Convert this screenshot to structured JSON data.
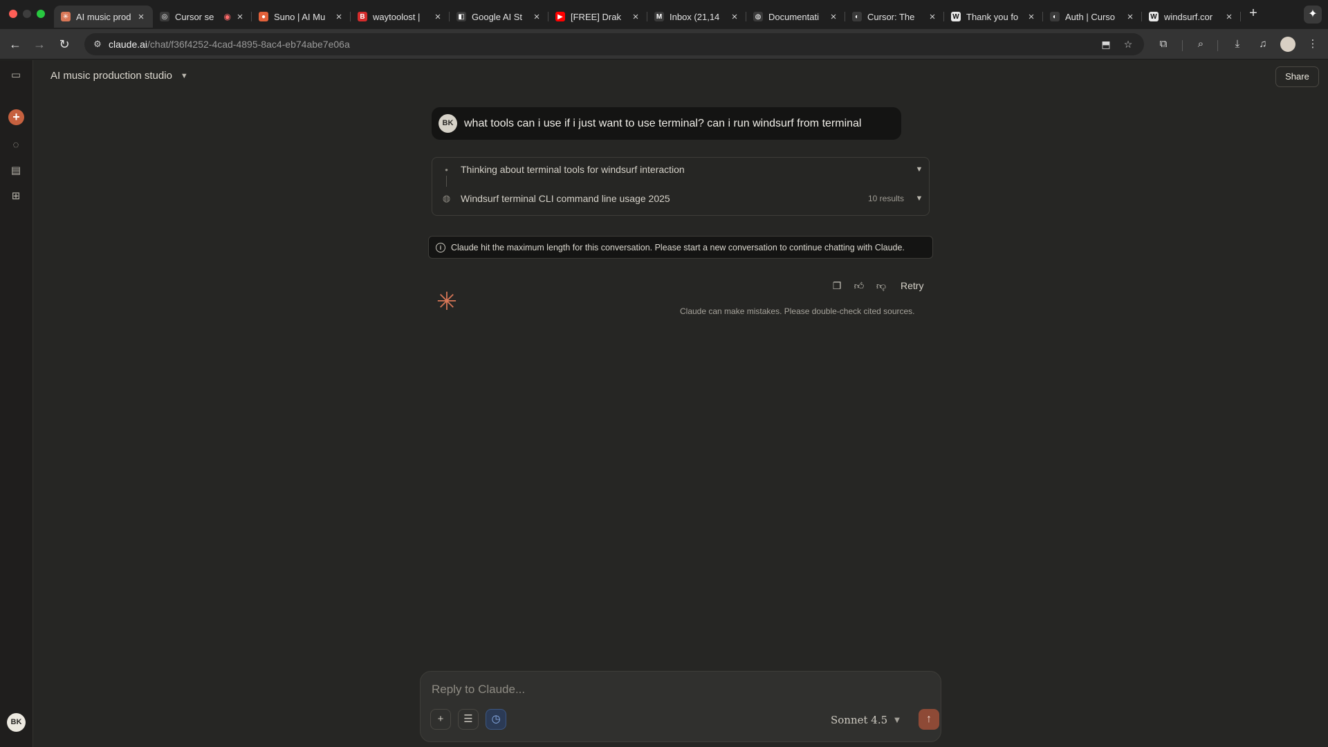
{
  "browser": {
    "tabs": [
      {
        "title": "AI music prod",
        "active": true,
        "favicon": "claude-icon",
        "fav_color": "#d97757",
        "fav_glyph": "✳"
      },
      {
        "title": "Cursor se",
        "active": false,
        "favicon": "cursor-icon",
        "fav_color": "#3a3a3a",
        "fav_glyph": "◎",
        "badge": "recording-icon"
      },
      {
        "title": "Suno | AI Mu",
        "active": false,
        "favicon": "suno-icon",
        "fav_color": "#e2613a",
        "fav_glyph": "●"
      },
      {
        "title": "waytoolost |",
        "active": false,
        "favicon": "bandcamp-icon",
        "fav_color": "#d42b2b",
        "fav_glyph": "B"
      },
      {
        "title": "Google AI St",
        "active": false,
        "favicon": "google-ai-studio-icon",
        "fav_color": "#3a3a3a",
        "fav_glyph": "◧"
      },
      {
        "title": "[FREE] Drak",
        "active": false,
        "favicon": "youtube-icon",
        "fav_color": "#ff0000",
        "fav_glyph": "▶"
      },
      {
        "title": "Inbox (21,14",
        "active": false,
        "favicon": "gmail-icon",
        "fav_color": "#3a3a3a",
        "fav_glyph": "M"
      },
      {
        "title": "Documentati",
        "active": false,
        "favicon": "globe-icon",
        "fav_color": "#3a3a3a",
        "fav_glyph": "◍"
      },
      {
        "title": "Cursor: The",
        "active": false,
        "favicon": "cursor-icon",
        "fav_color": "#3a3a3a",
        "fav_glyph": "◐"
      },
      {
        "title": "Thank you fo",
        "active": false,
        "favicon": "windsurf-icon",
        "fav_color": "#e8e8e8",
        "fav_glyph": "W"
      },
      {
        "title": "Auth | Curso",
        "active": false,
        "favicon": "cursor-icon",
        "fav_color": "#3a3a3a",
        "fav_glyph": "◐"
      },
      {
        "title": "windsurf.cor",
        "active": false,
        "favicon": "windsurf-icon",
        "fav_color": "#e8e8e8",
        "fav_glyph": "W"
      }
    ],
    "url_host": "claude.ai",
    "url_path": "/chat/f36f4252-4cad-4895-8ac4-eb74abe7e06a"
  },
  "app": {
    "conversation_title": "AI music production studio",
    "share_label": "Share",
    "user_initials": "BK",
    "user_message": "what tools can i use if i just want to use terminal? can i run windsurf from terminal",
    "thinking_label": "Thinking about terminal tools for windsurf interaction",
    "search_label": "Windsurf terminal CLI command line usage 2025",
    "search_results": "10 results",
    "limit_message": "Claude hit the maximum length for this conversation. Please start a new conversation to continue chatting with Claude.",
    "retry_label": "Retry",
    "disclaimer": "Claude can make mistakes. Please double-check cited sources.",
    "composer_placeholder": "Reply to Claude...",
    "model_name": "Sonnet 4.5"
  },
  "colors": {
    "accent": "#c6613f",
    "claude_orange": "#d97757",
    "background": "#262624"
  }
}
